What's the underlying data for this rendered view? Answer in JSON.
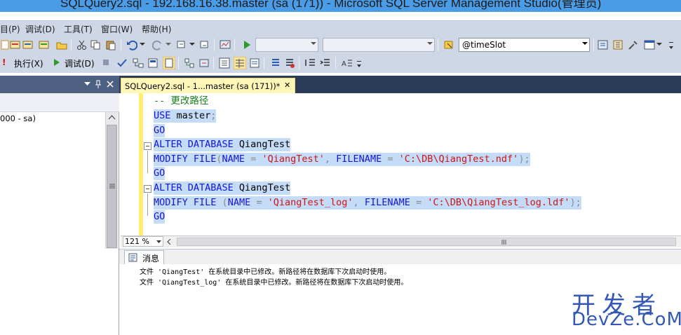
{
  "window": {
    "title": "SQLQuery2.sql - 192.168.16.38.master (sa (171)) - Microsoft SQL Server Management Studio(管理员)"
  },
  "menu": {
    "items": [
      "目(P)",
      "调试(D)",
      "工具(T)",
      "窗口(W)",
      "帮助(H)"
    ]
  },
  "toolbar1": {
    "param_combo_value": "@timeSlot"
  },
  "toolbar2": {
    "execute_label": "执行(X)",
    "debug_label": "调试(D)"
  },
  "object_explorer": {
    "tree_item": "000 - sa)"
  },
  "editor": {
    "tab_label": "SQLQuery2.sql - 1...master (sa (171))*",
    "tab_close": "✕",
    "zoom": "121 %",
    "lines": [
      {
        "t": "comment",
        "text": "-- 更改路径"
      },
      {
        "t": "code",
        "parts": [
          [
            "kw",
            "USE"
          ],
          [
            "plain",
            " master"
          ],
          [
            "gr",
            ";"
          ]
        ]
      },
      {
        "t": "code",
        "parts": [
          [
            "kw",
            "GO"
          ]
        ]
      },
      {
        "t": "code",
        "parts": [
          [
            "kw",
            "ALTER DATABASE"
          ],
          [
            "plain",
            " QiangTest"
          ]
        ]
      },
      {
        "t": "code",
        "parts": [
          [
            "kw",
            "MODIFY FILE"
          ],
          [
            "gr",
            "("
          ],
          [
            "kw",
            "NAME"
          ],
          [
            "plain",
            " "
          ],
          [
            "gr",
            "="
          ],
          [
            "plain",
            " "
          ],
          [
            "str",
            "'QiangTest'"
          ],
          [
            "gr",
            ","
          ],
          [
            "plain",
            " "
          ],
          [
            "kw",
            "FILENAME"
          ],
          [
            "plain",
            " "
          ],
          [
            "gr",
            "="
          ],
          [
            "plain",
            " "
          ],
          [
            "str",
            "'C:\\DB\\QiangTest.ndf'"
          ],
          [
            "gr",
            ");"
          ]
        ]
      },
      {
        "t": "code",
        "parts": [
          [
            "kw",
            "GO"
          ]
        ]
      },
      {
        "t": "code",
        "parts": [
          [
            "kw",
            "ALTER DATABASE"
          ],
          [
            "plain",
            " QiangTest"
          ]
        ]
      },
      {
        "t": "code",
        "parts": [
          [
            "kw",
            "MODIFY FILE"
          ],
          [
            "plain",
            " "
          ],
          [
            "gr",
            "("
          ],
          [
            "kw",
            "NAME"
          ],
          [
            "plain",
            " "
          ],
          [
            "gr",
            "="
          ],
          [
            "plain",
            " "
          ],
          [
            "str",
            "'QiangTest_log'"
          ],
          [
            "gr",
            ","
          ],
          [
            "plain",
            " "
          ],
          [
            "kw",
            "FILENAME"
          ],
          [
            "plain",
            " "
          ],
          [
            "gr",
            "="
          ],
          [
            "plain",
            " "
          ],
          [
            "str",
            "'C:\\DB\\QiangTest_log.ldf'"
          ],
          [
            "gr",
            ");"
          ]
        ]
      },
      {
        "t": "code",
        "parts": [
          [
            "kw",
            "GO"
          ]
        ]
      }
    ]
  },
  "results": {
    "tab_label": "消息",
    "messages": [
      "文件 'QiangTest' 在系统目录中已修改。新路径将在数据库下次启动时使用。",
      "文件 'QiangTest_log' 在系统目录中已修改。新路径将在数据库下次启动时使用。"
    ]
  },
  "watermark": {
    "line1": "开发者",
    "line2": "DevZe.CoM"
  },
  "colors": {
    "accent": "#3358b8",
    "selection": "#c4dcf7",
    "keyword": "#1515e0",
    "string": "#d11414"
  }
}
